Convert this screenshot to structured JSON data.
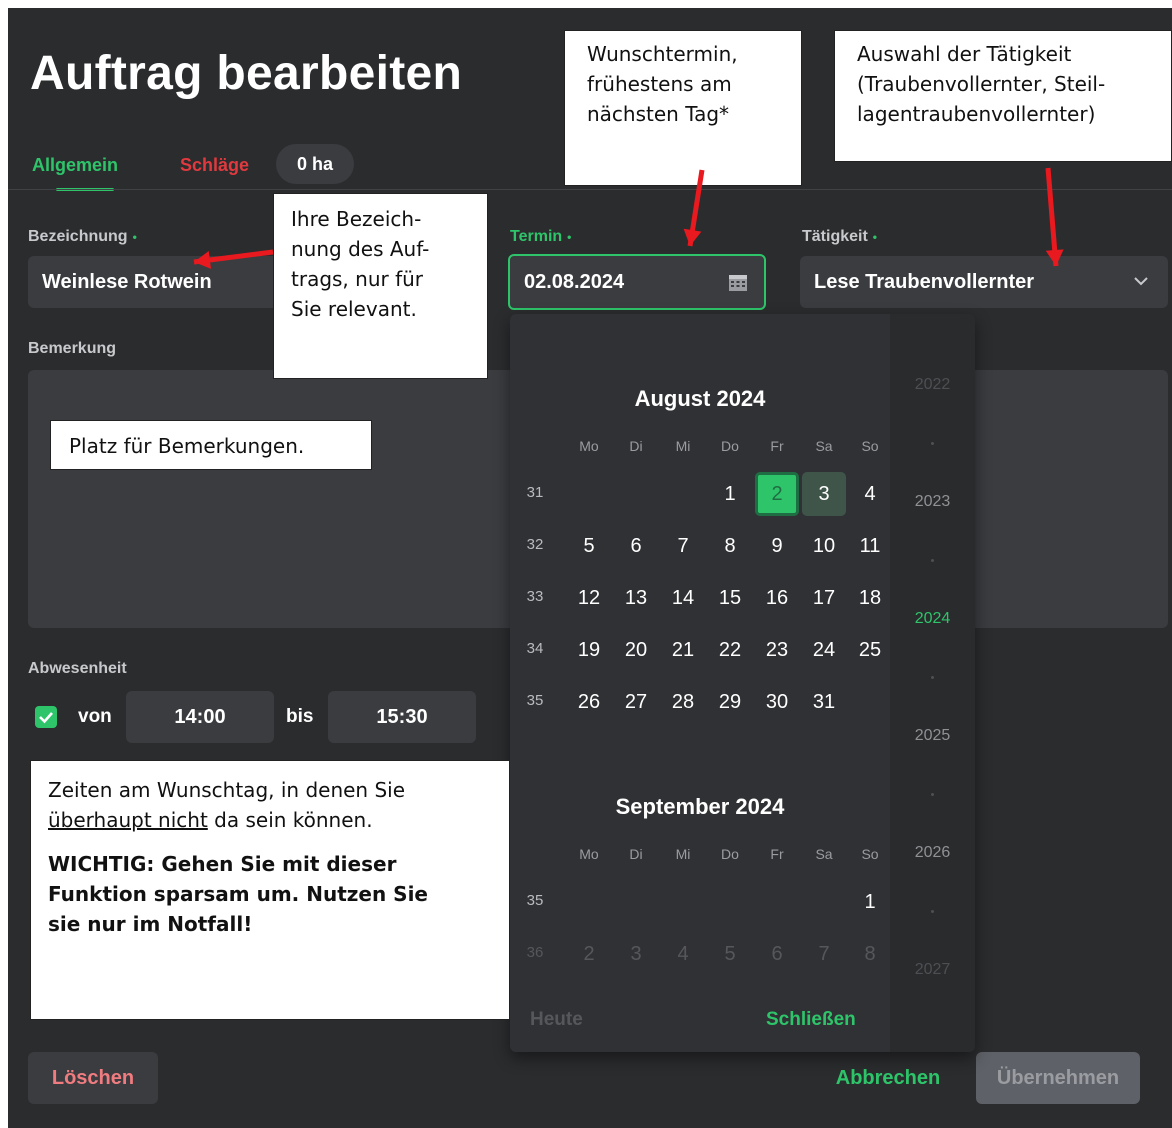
{
  "window": {
    "title": "Auftrag bearbeiten",
    "tabs": [
      {
        "label": "Allgemein",
        "active": true,
        "color": "#2ec56a"
      },
      {
        "label": "Schläge",
        "color": "#e0393e"
      }
    ],
    "area_chip": "0 ha"
  },
  "form": {
    "bezeichnung": {
      "label": "Bezeichnung",
      "required_mark": "•",
      "value": "Weinlese Rotwein"
    },
    "termin": {
      "label": "Termin",
      "required_mark": "•",
      "value": "02.08.2024",
      "icon": "calendar-icon"
    },
    "taetigkeit": {
      "label": "Tätigkeit",
      "required_mark": "•",
      "value": "Lese Traubenvollernter",
      "icon": "chevron-down-icon"
    },
    "bemerkung": {
      "label": "Bemerkung",
      "value": ""
    },
    "abwesenheit": {
      "label": "Abwesenheit",
      "checked": true,
      "von_label": "von",
      "von_value": "14:00",
      "bis_label": "bis",
      "bis_value": "15:30"
    }
  },
  "buttons": {
    "loeschen": "Löschen",
    "abbrechen": "Abbrechen",
    "uebernehmen": "Übernehmen"
  },
  "datepicker": {
    "months": [
      {
        "title": "August 2024",
        "weekdays": [
          "Mo",
          "Di",
          "Mi",
          "Do",
          "Fr",
          "Sa",
          "So"
        ],
        "weeks": [
          {
            "kw": "31",
            "days": [
              "",
              "",
              "",
              "1",
              "2",
              "3",
              "4"
            ]
          },
          {
            "kw": "32",
            "days": [
              "5",
              "6",
              "7",
              "8",
              "9",
              "10",
              "11"
            ]
          },
          {
            "kw": "33",
            "days": [
              "12",
              "13",
              "14",
              "15",
              "16",
              "17",
              "18"
            ]
          },
          {
            "kw": "34",
            "days": [
              "19",
              "20",
              "21",
              "22",
              "23",
              "24",
              "25"
            ]
          },
          {
            "kw": "35",
            "days": [
              "26",
              "27",
              "28",
              "29",
              "30",
              "31",
              ""
            ]
          }
        ],
        "selected_day": "2",
        "highlight_day": "3"
      },
      {
        "title": "September 2024",
        "weekdays": [
          "Mo",
          "Di",
          "Mi",
          "Do",
          "Fr",
          "Sa",
          "So"
        ],
        "weeks": [
          {
            "kw": "35",
            "days": [
              "",
              "",
              "",
              "",
              "",
              "",
              "1"
            ]
          },
          {
            "kw": "36",
            "days": [
              "2",
              "3",
              "4",
              "5",
              "6",
              "7",
              "8"
            ],
            "faded": true
          }
        ]
      }
    ],
    "years": [
      {
        "label": "2022",
        "state": "faded"
      },
      {
        "label": "2023",
        "state": "normal"
      },
      {
        "label": "2024",
        "state": "selected"
      },
      {
        "label": "2025",
        "state": "normal"
      },
      {
        "label": "2026",
        "state": "normal"
      },
      {
        "label": "2027",
        "state": "faded"
      }
    ],
    "today_label": "Heute",
    "close_label": "Schließen"
  },
  "annotations": {
    "wunschtermin": [
      "Wunschtermin,",
      "frühestens am",
      "nächsten Tag*"
    ],
    "taetigkeit": [
      "Auswahl der Tätigkeit",
      "(Traubenvollernter, Steil-",
      "lagentraubenvollernter)"
    ],
    "bezeichnung": [
      "Ihre Bezeich-",
      "nung des Auf-",
      "trags, nur für",
      "Sie relevant."
    ],
    "bemerkung": "Platz für Bemerkungen.",
    "abwesenheit": {
      "line1": "Zeiten am Wunschtag, in denen Sie",
      "line2_underlined": "überhaupt nicht",
      "line2_rest": " da sein können.",
      "warning": [
        "WICHTIG: Gehen Sie mit dieser",
        "Funktion sparsam um. Nutzen Sie",
        "sie nur im Notfall!"
      ]
    },
    "arrow_color": "#e8191f"
  }
}
